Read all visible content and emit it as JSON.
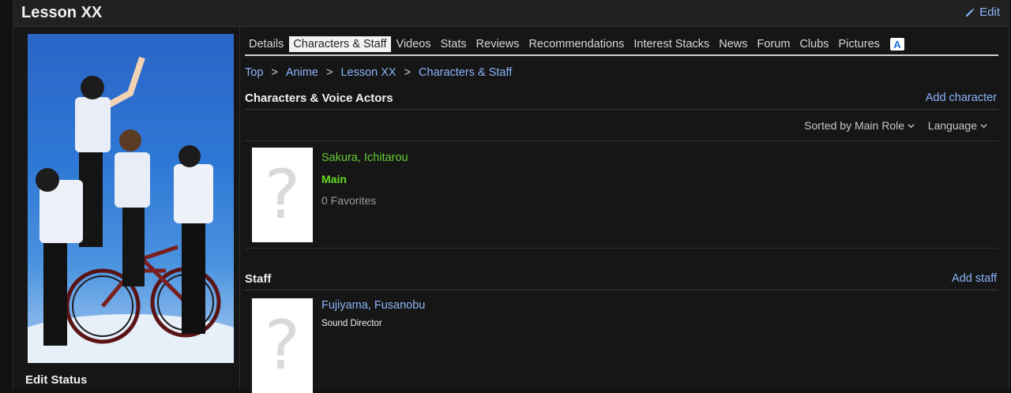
{
  "header": {
    "title": "Lesson XX",
    "edit_label": "Edit"
  },
  "sidebar": {
    "edit_status": "Edit Status"
  },
  "tabs": [
    {
      "label": "Details",
      "active": false
    },
    {
      "label": "Characters & Staff",
      "active": true
    },
    {
      "label": "Videos",
      "active": false
    },
    {
      "label": "Stats",
      "active": false
    },
    {
      "label": "Reviews",
      "active": false
    },
    {
      "label": "Recommendations",
      "active": false
    },
    {
      "label": "Interest Stacks",
      "active": false
    },
    {
      "label": "News",
      "active": false
    },
    {
      "label": "Forum",
      "active": false
    },
    {
      "label": "Clubs",
      "active": false
    },
    {
      "label": "Pictures",
      "active": false
    }
  ],
  "tab_icon_letter": "A",
  "breadcrumb": [
    "Top",
    "Anime",
    "Lesson XX",
    "Characters & Staff"
  ],
  "characters_section": {
    "title": "Characters & Voice Actors",
    "action": "Add character"
  },
  "sort": {
    "sorted_by": "Sorted by Main Role",
    "language": "Language"
  },
  "characters": [
    {
      "name": "Sakura, Ichitarou",
      "role": "Main",
      "favorites": "0 Favorites"
    }
  ],
  "staff_section": {
    "title": "Staff",
    "action": "Add staff"
  },
  "staff": [
    {
      "name": "Fujiyama, Fusanobu",
      "role": "Sound Director"
    }
  ],
  "placeholder_glyph": "?"
}
